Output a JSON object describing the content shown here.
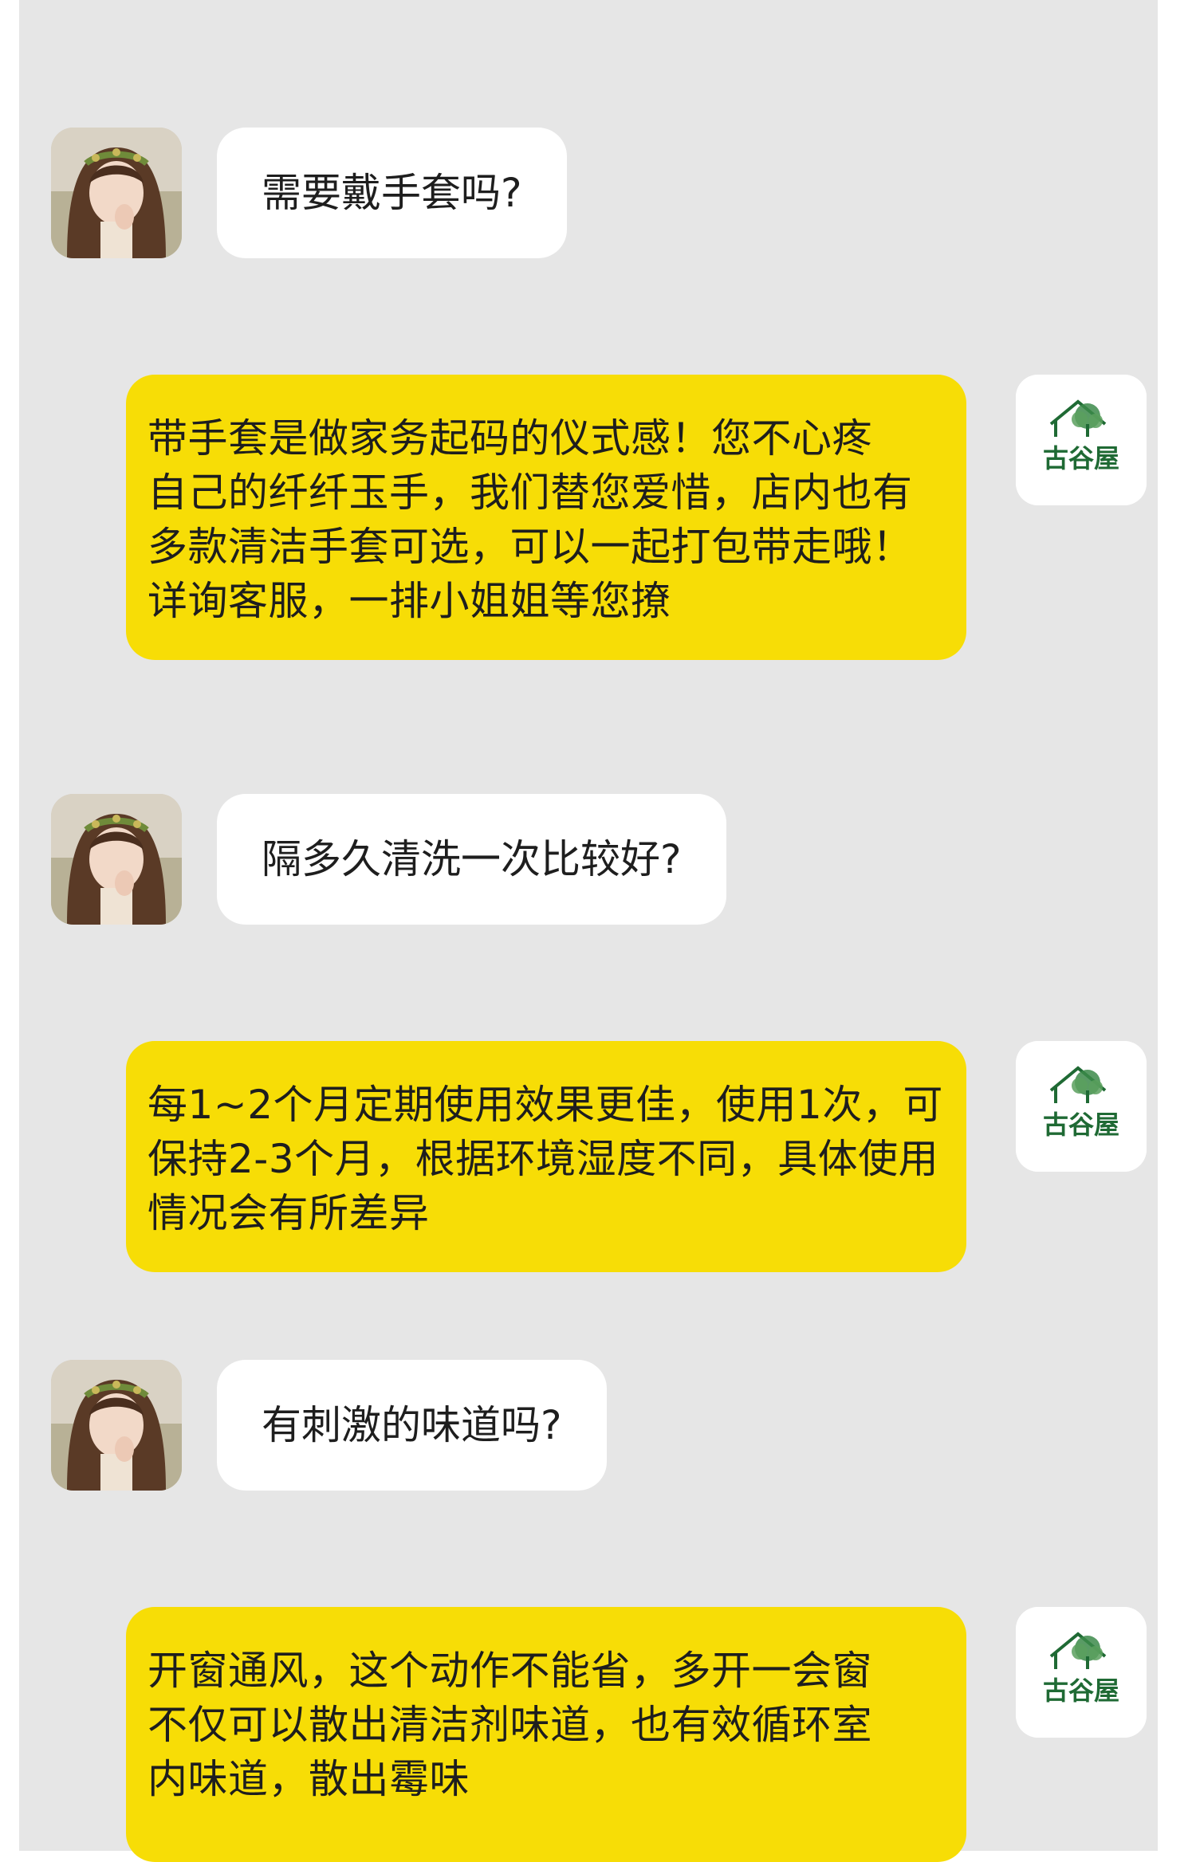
{
  "user": {
    "avatar_icon": "user-avatar-girl-flower-crown"
  },
  "brand": {
    "avatar_icon": "guguwu-logo-icon",
    "logo_text": "古谷屋",
    "logo_color": "#1f6a34"
  },
  "colors": {
    "panel_bg": "#e6e6e6",
    "user_bubble": "#ffffff",
    "brand_bubble": "#f7dd06"
  },
  "messages": [
    {
      "sender": "user",
      "text": "需要戴手套吗?"
    },
    {
      "sender": "brand",
      "lines": [
        "带手套是做家务起码的仪式感！您不心疼",
        "自己的纤纤玉手，我们替您爱惜，店内也有",
        "多款清洁手套可选，可以一起打包带走哦！",
        "详询客服，一排小姐姐等您撩"
      ]
    },
    {
      "sender": "user",
      "text": "隔多久清洗一次比较好?"
    },
    {
      "sender": "brand",
      "lines": [
        "每1~2个月定期使用效果更佳，使用1次，可",
        "保持2-3个月，根据环境湿度不同，具体使用",
        "情况会有所差异"
      ]
    },
    {
      "sender": "user",
      "text": "有刺激的味道吗?"
    },
    {
      "sender": "brand",
      "lines": [
        "开窗通风，这个动作不能省，多开一会窗",
        "不仅可以散出清洁剂味道，也有效循环室",
        "内味道，散出霉味"
      ]
    }
  ]
}
